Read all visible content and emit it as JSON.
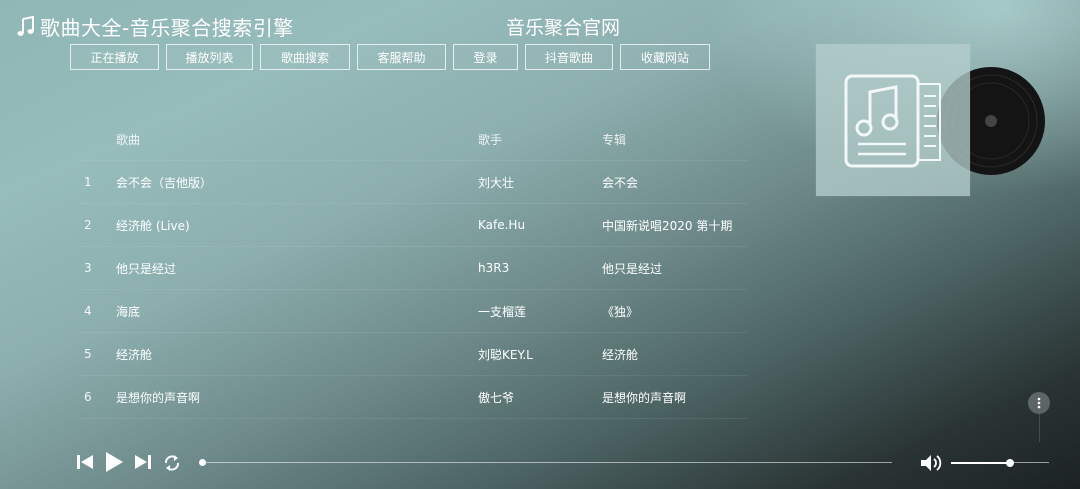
{
  "header": {
    "brand_title": "歌曲大全-音乐聚合搜索引擎",
    "brand_icon": "music-note-icon",
    "site_title": "音乐聚合官网"
  },
  "nav": {
    "items": [
      {
        "label": "正在播放"
      },
      {
        "label": "播放列表"
      },
      {
        "label": "歌曲搜索"
      },
      {
        "label": "客服帮助"
      },
      {
        "label": "登录"
      },
      {
        "label": "抖音歌曲"
      },
      {
        "label": "收藏网站"
      }
    ]
  },
  "playlist": {
    "columns": {
      "song": "歌曲",
      "artist": "歌手",
      "album": "专辑"
    },
    "rows": [
      {
        "num": "1",
        "song": "会不会（吉他版）",
        "artist": "刘大壮",
        "album": "会不会"
      },
      {
        "num": "2",
        "song": "经济舱 (Live)",
        "artist": "Kafe.Hu",
        "album": "中国新说唱2020 第十期"
      },
      {
        "num": "3",
        "song": "他只是经过",
        "artist": "h3R3",
        "album": "他只是经过"
      },
      {
        "num": "4",
        "song": "海底",
        "artist": "一支榴莲",
        "album": "《独》"
      },
      {
        "num": "5",
        "song": "经济舱",
        "artist": "刘聪KEY.L",
        "album": "经济舱"
      },
      {
        "num": "6",
        "song": "是想你的声音啊",
        "artist": "傲七爷",
        "album": "是想你的声音啊"
      }
    ]
  },
  "player": {
    "progress": 0,
    "volume": 0.6,
    "icons": {
      "prev": "skip-previous-icon",
      "play": "play-icon",
      "next": "skip-next-icon",
      "loop": "loop-icon",
      "volume": "volume-icon",
      "more": "more-vertical-icon"
    }
  },
  "colors": {
    "text": "#ffffff",
    "background_top": "#96bcbb",
    "background_bottom": "#1c2222"
  }
}
